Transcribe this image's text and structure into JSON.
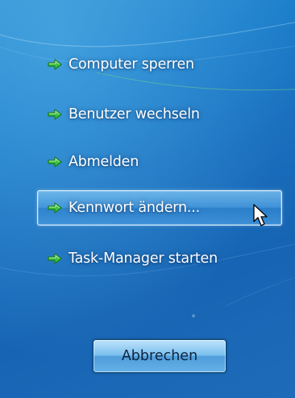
{
  "menu": {
    "items": [
      {
        "label": "Computer sperren",
        "icon": "green-arrow-icon"
      },
      {
        "label": "Benutzer wechseln",
        "icon": "green-arrow-icon"
      },
      {
        "label": "Abmelden",
        "icon": "green-arrow-icon"
      },
      {
        "label": "Kennwort ändern...",
        "icon": "green-arrow-icon",
        "state": "hover"
      },
      {
        "label": "Task-Manager starten",
        "icon": "green-arrow-icon"
      }
    ]
  },
  "cancel_button": {
    "label": "Abbrechen"
  },
  "cursor": {
    "icon": "mouse-pointer-icon"
  },
  "colors": {
    "background": "#1a6fbe",
    "arrow": "#3cc83c",
    "label": "#ffffff",
    "cancel_text": "#0f2440"
  }
}
